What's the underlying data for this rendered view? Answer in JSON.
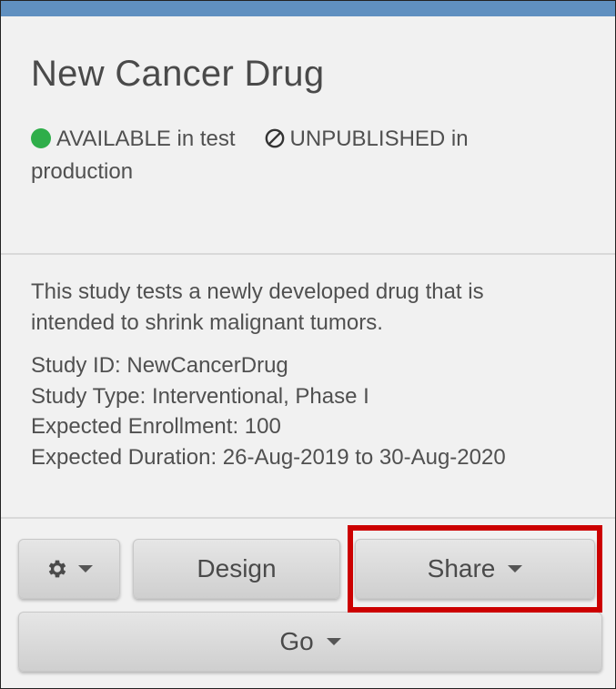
{
  "study": {
    "title": "New Cancer Drug",
    "status_test": "AVAILABLE in test",
    "status_prod_line1": "UNPUBLISHED in",
    "status_prod_line2": "production",
    "description_line1": "This study tests a newly developed drug that is",
    "description_line2": "intended to shrink malignant tumors.",
    "study_id": "Study ID: NewCancerDrug",
    "study_type": "Study Type: Interventional, Phase I",
    "enrollment": "Expected Enrollment: 100",
    "duration": "Expected Duration: 26-Aug-2019 to 30-Aug-2020"
  },
  "actions": {
    "settings_icon": "gear-icon",
    "design_label": "Design",
    "share_label": "Share",
    "go_label": "Go"
  },
  "colors": {
    "topbar": "#6090c0",
    "available": "#2fae4a",
    "highlight": "#cc0000"
  }
}
